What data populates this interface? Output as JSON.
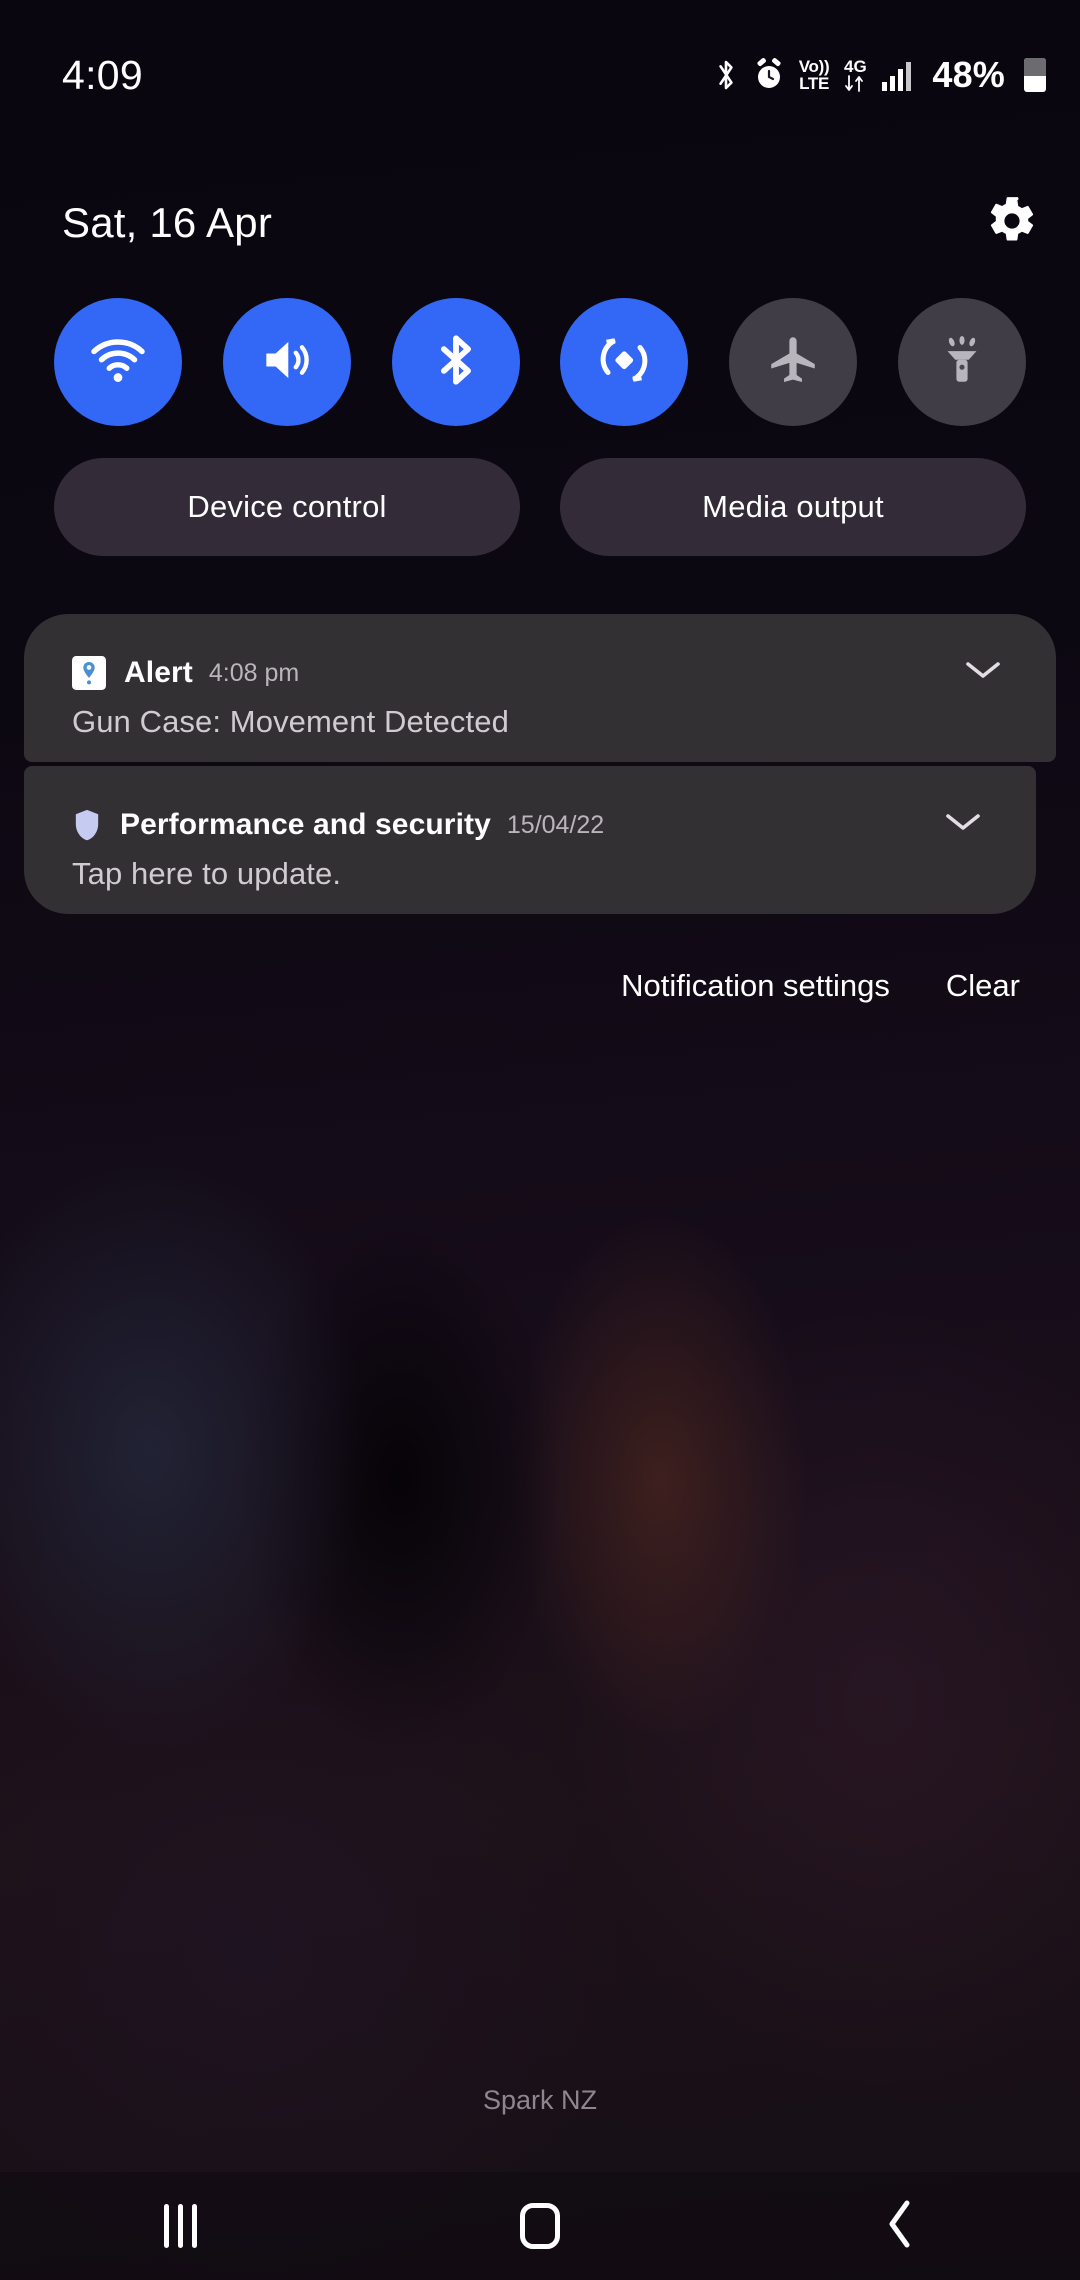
{
  "status_bar": {
    "time": "4:09",
    "battery_percent": "48%",
    "icons": [
      "bluetooth-icon",
      "alarm-icon",
      "volte-icon",
      "4g-data-icon",
      "signal-bars-icon",
      "battery-icon"
    ],
    "volte_top": "Vo))",
    "volte_bottom": "LTE",
    "network_label": "4G"
  },
  "header": {
    "date": "Sat, 16 Apr",
    "settings_label": "gear-icon"
  },
  "quick_settings": {
    "toggles": [
      {
        "name": "wifi",
        "label": "Wi-Fi",
        "state": "on"
      },
      {
        "name": "sound",
        "label": "Sound",
        "state": "on"
      },
      {
        "name": "bluetooth",
        "label": "Bluetooth",
        "state": "on"
      },
      {
        "name": "auto-rotate",
        "label": "Auto rotate",
        "state": "on"
      },
      {
        "name": "airplane-mode",
        "label": "Flight mode",
        "state": "off"
      },
      {
        "name": "flashlight",
        "label": "Flashlight",
        "state": "off"
      }
    ],
    "active_color": "#3367f6",
    "inactive_color": "#413d47"
  },
  "pills": {
    "device_control": "Device control",
    "media_output": "Media output"
  },
  "notifications": [
    {
      "app": "Alert",
      "time": "4:08 pm",
      "body": "Gun Case: Movement Detected",
      "icon": "location-pin-icon"
    },
    {
      "app": "Performance and security",
      "time": "15/04/22",
      "body": "Tap here to update.",
      "icon": "shield-icon"
    }
  ],
  "notification_actions": {
    "settings": "Notification settings",
    "clear": "Clear"
  },
  "footer": {
    "carrier": "Spark NZ"
  },
  "nav_bar": {
    "recents": "recents-icon",
    "home": "home-icon",
    "back": "back-icon"
  }
}
